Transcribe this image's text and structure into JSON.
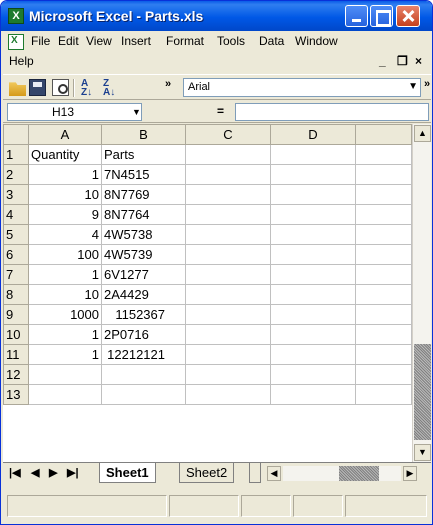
{
  "window": {
    "title": "Microsoft Excel - Parts.xls",
    "app_icon_letter": "X"
  },
  "menu": {
    "items": [
      "File",
      "Edit",
      "View",
      "Insert",
      "Format",
      "Tools",
      "Data",
      "Window",
      "Help"
    ],
    "mdi_controls": [
      "_",
      "❒",
      "×"
    ]
  },
  "toolbar": {
    "font_name": "Arial",
    "overflow": "»"
  },
  "formula_bar": {
    "name_box": "H13",
    "equals": "=",
    "formula": ""
  },
  "sheet": {
    "columns": [
      "A",
      "B",
      "C",
      "D"
    ],
    "rows": [
      {
        "n": "1",
        "a": "Quantity",
        "b": "Parts"
      },
      {
        "n": "2",
        "a": "1",
        "b": "7N4515"
      },
      {
        "n": "3",
        "a": "10",
        "b": "8N7769"
      },
      {
        "n": "4",
        "a": "9",
        "b": "8N7764"
      },
      {
        "n": "5",
        "a": "4",
        "b": "4W5738"
      },
      {
        "n": "6",
        "a": "100",
        "b": "4W5739"
      },
      {
        "n": "7",
        "a": "1",
        "b": "6V1277"
      },
      {
        "n": "8",
        "a": "10",
        "b": "2A4429"
      },
      {
        "n": "9",
        "a": "1000",
        "b": "1152367"
      },
      {
        "n": "10",
        "a": "1",
        "b": "2P0716"
      },
      {
        "n": "11",
        "a": "1",
        "b": "12212121"
      },
      {
        "n": "12",
        "a": "",
        "b": ""
      },
      {
        "n": "13",
        "a": "",
        "b": ""
      }
    ]
  },
  "tabs": {
    "active": "Sheet1",
    "other": "Sheet2"
  }
}
